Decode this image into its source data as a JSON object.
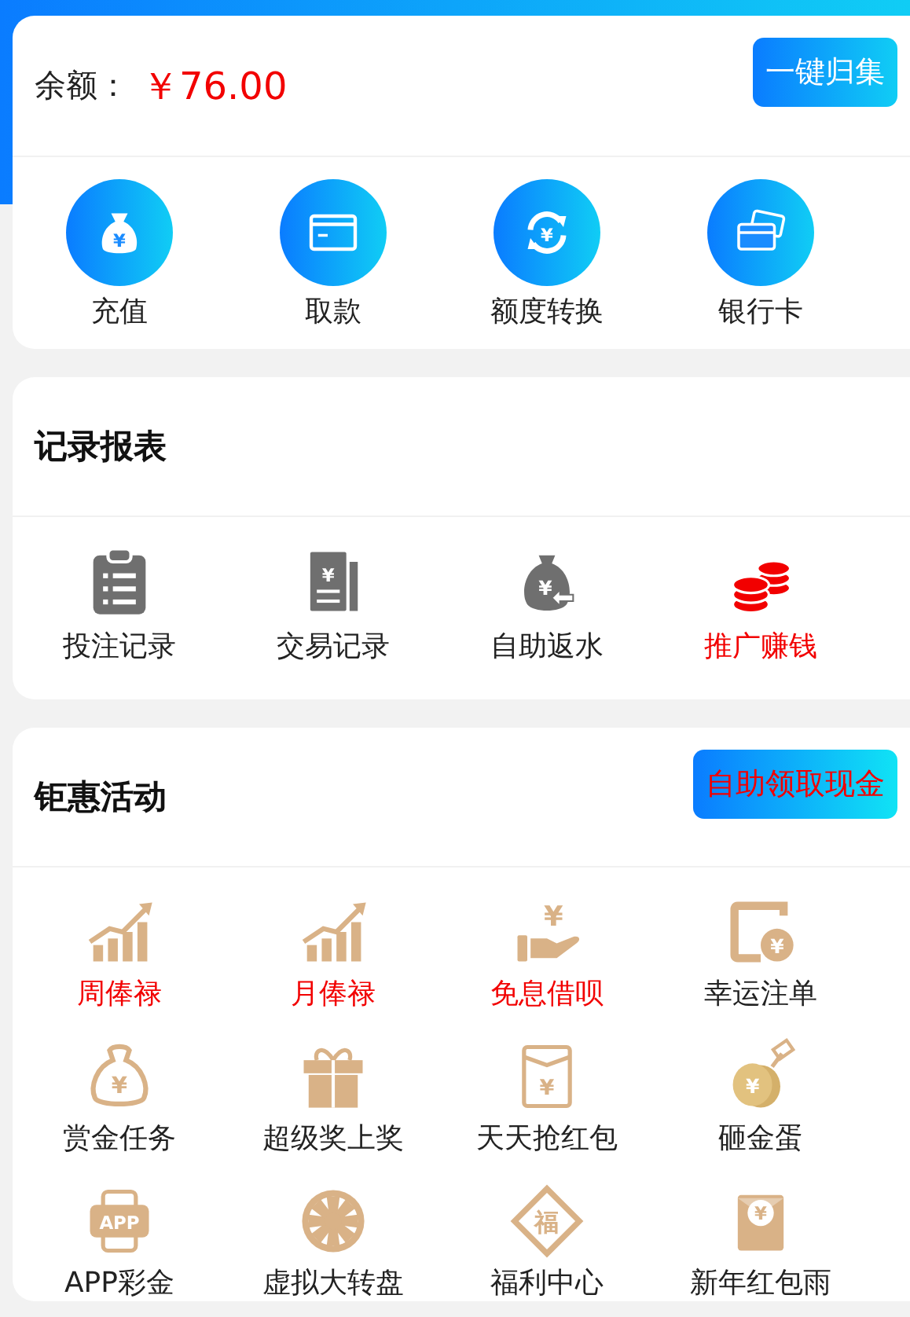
{
  "balance": {
    "label": "余额：",
    "amount": "￥76.00"
  },
  "collect_button": "一键归集",
  "wallet_actions": [
    {
      "label": "充值",
      "kind": "money-bag",
      "glyph": "¥"
    },
    {
      "label": "取款",
      "kind": "card"
    },
    {
      "label": "额度转换",
      "kind": "exchange",
      "glyph": "¥"
    },
    {
      "label": "银行卡",
      "kind": "bank-cards"
    }
  ],
  "records": {
    "title": "记录报表",
    "items": [
      {
        "label": "投注记录",
        "kind": "clipboard",
        "highlight": false
      },
      {
        "label": "交易记录",
        "kind": "receipt",
        "glyph": "¥",
        "highlight": false
      },
      {
        "label": "自助返水",
        "kind": "bag-return",
        "glyph": "¥",
        "highlight": false
      },
      {
        "label": "推广赚钱",
        "kind": "coins",
        "highlight": true
      }
    ]
  },
  "promotions": {
    "title": "钜惠活动",
    "button": "自助领取现金",
    "items": [
      {
        "label": "周俸禄",
        "kind": "chart-up",
        "highlight": true
      },
      {
        "label": "月俸禄",
        "kind": "chart-up",
        "highlight": true
      },
      {
        "label": "免息借呗",
        "kind": "hand-coin",
        "glyph": "¥",
        "highlight": true
      },
      {
        "label": "幸运注单",
        "kind": "wallet-coin",
        "glyph": "¥",
        "highlight": false
      },
      {
        "label": "赏金任务",
        "kind": "bag-outline",
        "glyph": "¥",
        "highlight": false
      },
      {
        "label": "超级奖上奖",
        "kind": "gift",
        "highlight": false
      },
      {
        "label": "天天抢红包",
        "kind": "envelope",
        "glyph": "¥",
        "highlight": false
      },
      {
        "label": "砸金蛋",
        "kind": "egg-hammer",
        "glyph": "¥",
        "highlight": false
      },
      {
        "label": "APP彩金",
        "kind": "phone-app",
        "glyph": "APP",
        "highlight": false
      },
      {
        "label": "虚拟大转盘",
        "kind": "wheel",
        "highlight": false
      },
      {
        "label": "福利中心",
        "kind": "diamond",
        "glyph": "福",
        "highlight": false
      },
      {
        "label": "新年红包雨",
        "kind": "packet",
        "glyph": "¥",
        "highlight": false
      }
    ]
  }
}
